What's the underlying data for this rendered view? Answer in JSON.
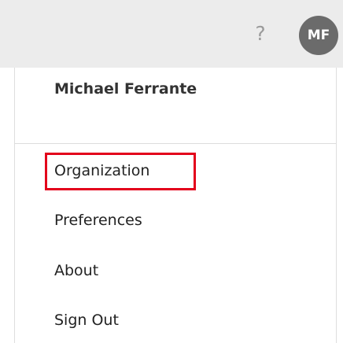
{
  "header": {
    "help_label": "?",
    "avatar_initials": "MF"
  },
  "menu": {
    "user_name": "Michael Ferrante",
    "items": [
      {
        "label": "Organization"
      },
      {
        "label": "Preferences"
      },
      {
        "label": "About"
      },
      {
        "label": "Sign Out"
      }
    ]
  },
  "colors": {
    "highlight": "#e3001b",
    "avatar_bg": "#6b6b6b",
    "topbar_bg": "#ececec"
  }
}
